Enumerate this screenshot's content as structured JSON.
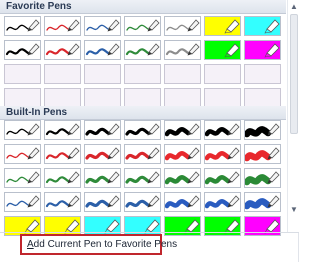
{
  "favorite_pens": {
    "header": "Favorite Pens",
    "rows": [
      [
        {
          "type": "pen",
          "color": "#000000",
          "kind": "thin"
        },
        {
          "type": "pen",
          "color": "#d9262b",
          "kind": "thin"
        },
        {
          "type": "pen",
          "color": "#2b5fa8",
          "kind": "thin"
        },
        {
          "type": "pen",
          "color": "#2f8b3a",
          "kind": "thin"
        },
        {
          "type": "pen",
          "color": "#8c8c8c",
          "kind": "thin"
        },
        {
          "type": "highlighter",
          "color": "#ffff00"
        },
        {
          "type": "highlighter",
          "color": "#33ffff"
        }
      ],
      [
        {
          "type": "pen",
          "color": "#000000",
          "kind": "medium"
        },
        {
          "type": "pen",
          "color": "#d9262b",
          "kind": "medium"
        },
        {
          "type": "pen",
          "color": "#2b5fa8",
          "kind": "medium"
        },
        {
          "type": "pen",
          "color": "#2f8b3a",
          "kind": "medium"
        },
        {
          "type": "pen",
          "color": "#8c8c8c",
          "kind": "medium"
        },
        {
          "type": "highlighter",
          "color": "#00ff00"
        },
        {
          "type": "highlighter",
          "color": "#ff00ff"
        }
      ],
      [
        {
          "type": "empty"
        },
        {
          "type": "empty"
        },
        {
          "type": "empty"
        },
        {
          "type": "empty"
        },
        {
          "type": "empty"
        },
        {
          "type": "empty"
        },
        {
          "type": "empty"
        }
      ],
      [
        {
          "type": "empty"
        },
        {
          "type": "empty"
        },
        {
          "type": "empty"
        },
        {
          "type": "empty"
        },
        {
          "type": "empty"
        },
        {
          "type": "empty"
        },
        {
          "type": "empty"
        }
      ]
    ]
  },
  "builtin_pens": {
    "header": "Built-In Pens",
    "rows": [
      [
        {
          "type": "pen",
          "color": "#000000",
          "kind": "thin"
        },
        {
          "type": "pen",
          "color": "#000000",
          "kind": "medium"
        },
        {
          "type": "pen",
          "color": "#000000",
          "kind": "thick"
        },
        {
          "type": "pen",
          "color": "#000000",
          "kind": "thick"
        },
        {
          "type": "pen",
          "color": "#000000",
          "kind": "bold"
        },
        {
          "type": "pen",
          "color": "#000000",
          "kind": "bold"
        },
        {
          "type": "pen",
          "color": "#000000",
          "kind": "heavy"
        }
      ],
      [
        {
          "type": "pen",
          "color": "#d9262b",
          "kind": "thin"
        },
        {
          "type": "pen",
          "color": "#d9262b",
          "kind": "medium"
        },
        {
          "type": "pen",
          "color": "#d9262b",
          "kind": "thick"
        },
        {
          "type": "pen",
          "color": "#d9262b",
          "kind": "thick"
        },
        {
          "type": "pen",
          "color": "#e8282d",
          "kind": "bold"
        },
        {
          "type": "pen",
          "color": "#e8282d",
          "kind": "bold"
        },
        {
          "type": "pen",
          "color": "#e8282d",
          "kind": "heavy"
        }
      ],
      [
        {
          "type": "pen",
          "color": "#2f8b3a",
          "kind": "thin"
        },
        {
          "type": "pen",
          "color": "#2f8b3a",
          "kind": "medium"
        },
        {
          "type": "pen",
          "color": "#2f8b3a",
          "kind": "thick"
        },
        {
          "type": "pen",
          "color": "#2f8b3a",
          "kind": "thick"
        },
        {
          "type": "pen",
          "color": "#2b8a36",
          "kind": "bold"
        },
        {
          "type": "pen",
          "color": "#2b8a36",
          "kind": "bold"
        },
        {
          "type": "pen",
          "color": "#2b8a36",
          "kind": "heavy"
        }
      ],
      [
        {
          "type": "pen",
          "color": "#2b5fa8",
          "kind": "thin"
        },
        {
          "type": "pen",
          "color": "#2b5fa8",
          "kind": "medium"
        },
        {
          "type": "pen",
          "color": "#2b5fa8",
          "kind": "thick"
        },
        {
          "type": "pen",
          "color": "#2b5fa8",
          "kind": "thick"
        },
        {
          "type": "pen",
          "color": "#2a5cc0",
          "kind": "bold"
        },
        {
          "type": "pen",
          "color": "#2a5cc0",
          "kind": "bold"
        },
        {
          "type": "pen",
          "color": "#2a5cc0",
          "kind": "heavy"
        }
      ],
      [
        {
          "type": "highlighter",
          "color": "#ffff00"
        },
        {
          "type": "highlighter",
          "color": "#ffff00"
        },
        {
          "type": "highlighter",
          "color": "#33ffff"
        },
        {
          "type": "highlighter",
          "color": "#33ffff"
        },
        {
          "type": "highlighter",
          "color": "#00ff00"
        },
        {
          "type": "highlighter",
          "color": "#00ff00"
        },
        {
          "type": "highlighter",
          "color": "#ff00ff"
        }
      ]
    ]
  },
  "footer": {
    "add_current_accel": "A",
    "add_current_rest": "dd Current Pen to Favorite Pens"
  }
}
